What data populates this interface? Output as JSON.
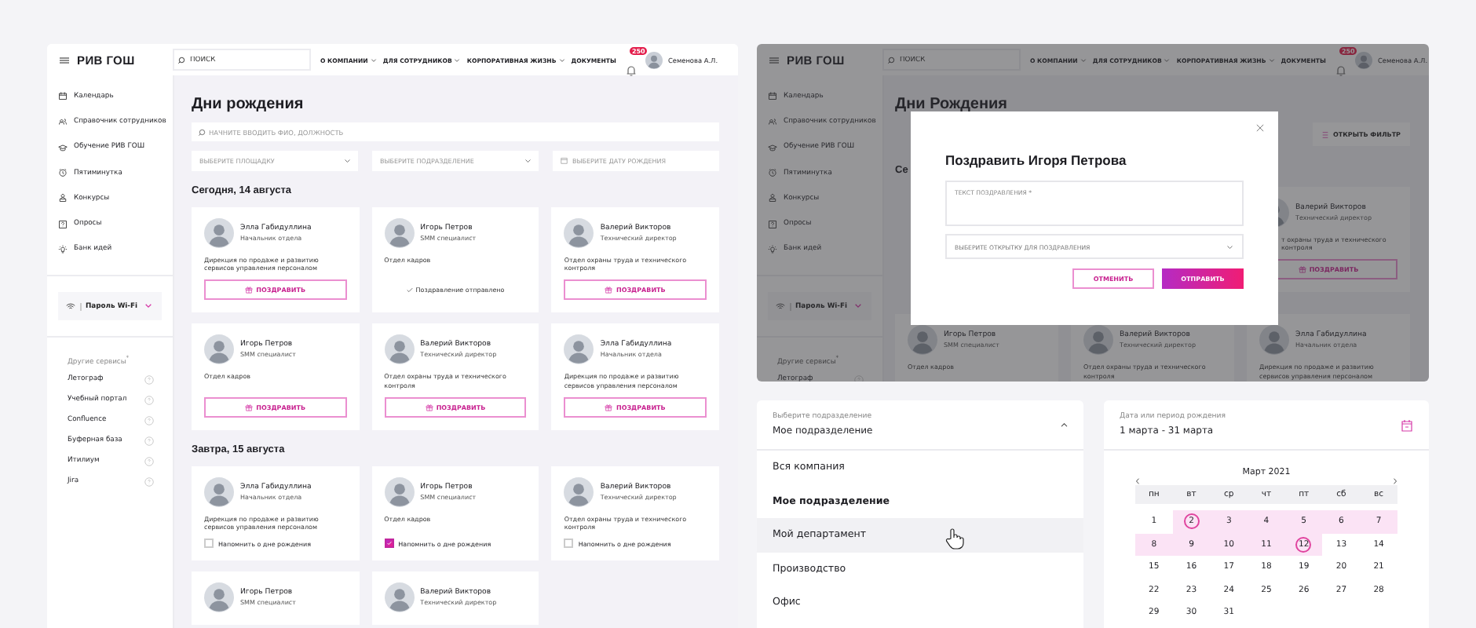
{
  "birthdays_page": {
    "header": {
      "logo": "РИВ ГОШ",
      "search_placeholder": "ПОИСК",
      "nav": [
        {
          "label": "О КОМПАНИИ",
          "dropdown": true
        },
        {
          "label": "ДЛЯ СОТРУДНИКОВ",
          "dropdown": true
        },
        {
          "label": "КОРПОРАТИВНАЯ ЖИЗНЬ",
          "dropdown": true
        },
        {
          "label": "ДОКУМЕНТЫ",
          "dropdown": false
        }
      ],
      "notifications": "250",
      "user": "Семенова А.Л."
    },
    "sidebar": {
      "items": [
        "Календарь",
        "Справочник сотрудников",
        "Обучение РИВ ГОШ",
        "Пятиминутка",
        "Конкурсы",
        "Опросы",
        "Банк идей"
      ],
      "wifi": {
        "label": "Пароль Wi-Fi",
        "expanded": false
      },
      "services_heading": "Другие сервисы$^{*}$",
      "services": [
        "Летограф",
        "Учебный портал",
        "Confluence",
        "Буферная база",
        "Итилиум",
        "Jira"
      ]
    },
    "title": "Дни рождения",
    "search_placeholder": "НАЧНИТЕ ВВОДИТЬ ФИО, ДОЛЖНОСТЬ",
    "filters": [
      {
        "kind": "select",
        "placeholder": "ВЫБЕРИТЕ ПЛОЩАДКУ"
      },
      {
        "kind": "select",
        "placeholder": "ВЫБЕРИТЕ ПОДРАЗДЕЛЕНИЕ"
      },
      {
        "kind": "date",
        "placeholder": "ВЫБЕРИТЕ ДАТУ РОЖДЕНИЯ"
      }
    ],
    "sections": [
      {
        "heading": "Сегодня, 14 августа",
        "cards": [
          {
            "name": "Элла Габидуллина",
            "position": "Начальник отдела",
            "department": "Дирекция по продаже и развитию сервисов управления персоналом",
            "kind": "congratulate",
            "action": "ПОЗДРАВИТЬ"
          },
          {
            "name": "Игорь Петров",
            "position": "SMM специалист",
            "department": "Отдел кадров",
            "kind": "sent",
            "action": "Поздравление отправлено"
          },
          {
            "name": "Валерий Викторов",
            "position": "Технический директор",
            "department": "Отдел охраны труда и технического контроля",
            "kind": "congratulate",
            "action": "ПОЗДРАВИТЬ"
          },
          {
            "name": "Игорь Петров",
            "position": "SMM специалист",
            "department": "Отдел кадров",
            "kind": "congratulate",
            "action": "ПОЗДРАВИТЬ"
          },
          {
            "name": "Валерий Викторов",
            "position": "Технический директор",
            "department": "Отдел охраны труда и технического контроля",
            "kind": "congratulate",
            "action": "ПОЗДРАВИТЬ"
          },
          {
            "name": "Элла Габидуллина",
            "position": "Начальник отдела",
            "department": "Дирекция по продаже и развитию сервисов управления персоналом",
            "kind": "congratulate",
            "action": "ПОЗДРАВИТЬ"
          }
        ]
      },
      {
        "heading": "Завтра, 15 августа",
        "cards": [
          {
            "name": "Элла Габидуллина",
            "position": "Начальник отдела",
            "department": "Дирекция по продаже и развитию сервисов управления персоналом",
            "kind": "remind",
            "action": "Напомнить о дне рождения",
            "checked": false
          },
          {
            "name": "Игорь Петров",
            "position": "SMM специалист",
            "department": "Отдел кадров",
            "kind": "remind",
            "action": "Напомнить о дне рождения",
            "checked": true
          },
          {
            "name": "Валерий Викторов",
            "position": "Технический директор",
            "department": "Отдел охраны труда и технического контроля",
            "kind": "remind",
            "action": "Напомнить о дне рождения",
            "checked": false
          },
          {
            "name": "Игорь Петров",
            "position": "SMM специалист"
          },
          {
            "name": "Валерий Викторов",
            "position": "Технический директор"
          }
        ]
      }
    ]
  },
  "congratulate_screen": {
    "header": {
      "logo": "РИВ ГОШ",
      "search_placeholder": "ПОИСК",
      "nav": [
        {
          "label": "О КОМПАНИИ",
          "dropdown": true
        },
        {
          "label": "ДЛЯ СОТРУДНИКОВ",
          "dropdown": true
        },
        {
          "label": "КОРПОРАТИВНАЯ ЖИЗНЬ",
          "dropdown": true
        },
        {
          "label": "ДОКУМЕНТЫ",
          "dropdown": false
        }
      ],
      "notifications": "250",
      "user": "Семенова А.Л."
    },
    "sidebar": {
      "items": [
        "Календарь",
        "Справочник сотрудников",
        "Обучение РИВ ГОШ",
        "Пятиминутка",
        "Конкурсы",
        "Опросы",
        "Банк идей"
      ],
      "wifi": {
        "label": "Пароль Wi-Fi",
        "expanded": false
      },
      "services_heading": "Другие сервисы$^{*}$",
      "services": [
        "Летограф"
      ]
    },
    "title": "Дни Рождения",
    "filter_button": "ОТКРЫТЬ ФИЛЬТР",
    "sections": [
      {
        "heading": "Се",
        "cards": [
          {
            "name": "Валерий Викторов",
            "position": "Технический директор",
            "department": "т охраны труда и технического контроля",
            "kind": "congratulate",
            "action": "ПОЗДРАВИТЬ"
          },
          {
            "name": "Игорь Петров",
            "position": "SMM специалист",
            "department": "Отдел кадров"
          },
          {
            "name": "Валерий Викторов",
            "position": "Технический директор",
            "department": "Отдел охраны труда и технического контроля"
          },
          {
            "name": "Элла Габидуллина",
            "position": "Начальник отдела",
            "department": "Дирекция по продаже и развитию сервисов управления персоналом"
          }
        ]
      }
    ],
    "modal": {
      "title": "Поздравить Игоря Петрова",
      "message_label": "ТЕКСТ ПОЗДРАВЛЕНИЯ *",
      "card_select": "ВЫБЕРИТЕ ОТКРЫТКУ ДЛЯ ПОЗДРАВЛЕНИЯ",
      "cancel": "ОТМЕНИТЬ",
      "send": "ОТПРАВИТЬ"
    }
  },
  "department_dropdown": {
    "label": "Выберите подразделение",
    "value": "Мое подразделение",
    "expanded": true,
    "options": [
      {
        "label": "Вся компания",
        "selected": false,
        "hovered": false
      },
      {
        "label": "Мое подразделение",
        "selected": true,
        "hovered": false
      },
      {
        "label": "Мой департамент",
        "selected": false,
        "hovered": true
      },
      {
        "label": "Производство",
        "selected": false,
        "hovered": false
      },
      {
        "label": "Офис",
        "selected": false,
        "hovered": false
      }
    ]
  },
  "date_picker": {
    "label": "Дата или период рождения",
    "value": "1 марта - 31 марта",
    "month": "Март 2021",
    "weekdays": [
      "пн",
      "вт",
      "ср",
      "чт",
      "пт",
      "сб",
      "вс"
    ],
    "days": [
      {
        "day": "1",
        "in_range": false,
        "endpoint": false
      },
      {
        "day": "2",
        "in_range": true,
        "endpoint": true
      },
      {
        "day": "3",
        "in_range": true,
        "endpoint": false
      },
      {
        "day": "4",
        "in_range": true,
        "endpoint": false
      },
      {
        "day": "5",
        "in_range": true,
        "endpoint": false
      },
      {
        "day": "6",
        "in_range": true,
        "endpoint": false
      },
      {
        "day": "7",
        "in_range": true,
        "endpoint": false
      },
      {
        "day": "8",
        "in_range": true,
        "endpoint": false
      },
      {
        "day": "9",
        "in_range": true,
        "endpoint": false
      },
      {
        "day": "10",
        "in_range": true,
        "endpoint": false
      },
      {
        "day": "11",
        "in_range": true,
        "endpoint": false
      },
      {
        "day": "12",
        "in_range": true,
        "endpoint": true
      },
      {
        "day": "13",
        "in_range": false,
        "endpoint": false
      },
      {
        "day": "14",
        "in_range": false,
        "endpoint": false
      },
      {
        "day": "15",
        "in_range": false,
        "endpoint": false
      },
      {
        "day": "16",
        "in_range": false,
        "endpoint": false
      },
      {
        "day": "17",
        "in_range": false,
        "endpoint": false
      },
      {
        "day": "18",
        "in_range": false,
        "endpoint": false
      },
      {
        "day": "19",
        "in_range": false,
        "endpoint": false
      },
      {
        "day": "20",
        "in_range": false,
        "endpoint": false
      },
      {
        "day": "21",
        "in_range": false,
        "endpoint": false
      },
      {
        "day": "22",
        "in_range": false,
        "endpoint": false
      },
      {
        "day": "23",
        "in_range": false,
        "endpoint": false
      },
      {
        "day": "24",
        "in_range": false,
        "endpoint": false
      },
      {
        "day": "25",
        "in_range": false,
        "endpoint": false
      },
      {
        "day": "26",
        "in_range": false,
        "endpoint": false
      },
      {
        "day": "27",
        "in_range": false,
        "endpoint": false
      },
      {
        "day": "28",
        "in_range": false,
        "endpoint": false
      },
      {
        "day": "29",
        "in_range": false,
        "endpoint": false
      },
      {
        "day": "30",
        "in_range": false,
        "endpoint": false
      },
      {
        "day": "31",
        "in_range": false,
        "endpoint": false
      }
    ]
  }
}
